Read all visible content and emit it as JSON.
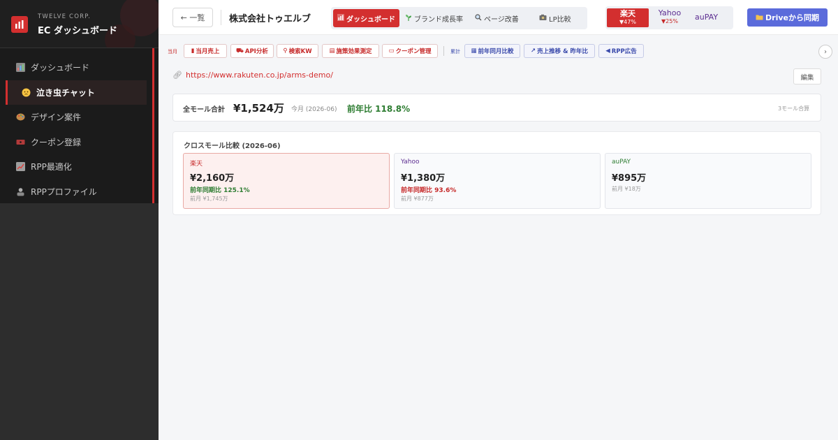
{
  "sidebar": {
    "brand_sub": "TWELVE CORP.",
    "brand_title": "EC ダッシュボード",
    "items": [
      {
        "label": "ダッシュボード",
        "icon": "chart-icon"
      },
      {
        "label": "泣き虫チャット",
        "icon": "crying-face-icon"
      },
      {
        "label": "デザイン案件",
        "icon": "palette-icon"
      },
      {
        "label": "クーポン登録",
        "icon": "ticket-icon"
      },
      {
        "label": "RPP最適化",
        "icon": "trend-icon"
      },
      {
        "label": "RPPプロファイル",
        "icon": "user-profile-icon"
      }
    ]
  },
  "header": {
    "back_label": "← 一覧",
    "company": "株式会社トゥエルブ",
    "tabs": [
      {
        "label": "ダッシュボード",
        "icon": "chart-icon"
      },
      {
        "label": "ブランド成長率",
        "icon": "sprout-icon"
      },
      {
        "label": "ページ改善",
        "icon": "magnifier-icon"
      },
      {
        "label": "LP比較",
        "icon": "camera-icon"
      }
    ],
    "malls": [
      {
        "name": "楽天",
        "change": "▼47%"
      },
      {
        "name": "Yahoo",
        "change": "▼25%"
      },
      {
        "name": "auPAY",
        "change": ""
      }
    ],
    "drive_label": "Driveから同期"
  },
  "subbar": {
    "current_label": "当月",
    "current_buttons": [
      "当月売上",
      "API分析",
      "検索KW",
      "施策効果測定",
      "クーポン管理"
    ],
    "cumulative_label": "累計",
    "cumulative_buttons": [
      "前年同月比較",
      "売上推移 & 昨年比",
      "RPP広告"
    ]
  },
  "url": "https://www.rakuten.co.jp/arms-demo/",
  "edit_label": "編集",
  "summary": {
    "label": "全モール合計",
    "value": "¥1,524万",
    "month": "今月 (2026-06)",
    "yoy": "前年比 118.8%",
    "note": "3モール合算"
  },
  "cross_mall": {
    "title": "クロスモール比較 (2026-06)",
    "cards": [
      {
        "name": "楽天",
        "value": "¥2,160万",
        "yoy": "前年同期比 125.1%",
        "prev": "前月 ¥1,745万"
      },
      {
        "name": "Yahoo",
        "value": "¥1,380万",
        "yoy": "前年同期比 93.6%",
        "prev": "前月 ¥877万"
      },
      {
        "name": "auPAY",
        "value": "¥895万",
        "yoy": "",
        "prev": "前月 ¥18万"
      }
    ]
  },
  "colors": {
    "accent": "#d32f2f",
    "sidebar_bg": "#1b1b1b",
    "drive_button": "#5b6bdb",
    "yoy_up": "#2e7d32",
    "yoy_down": "#c62828",
    "yahoo": "#5c2d91",
    "aupay": "#2e7d32"
  }
}
